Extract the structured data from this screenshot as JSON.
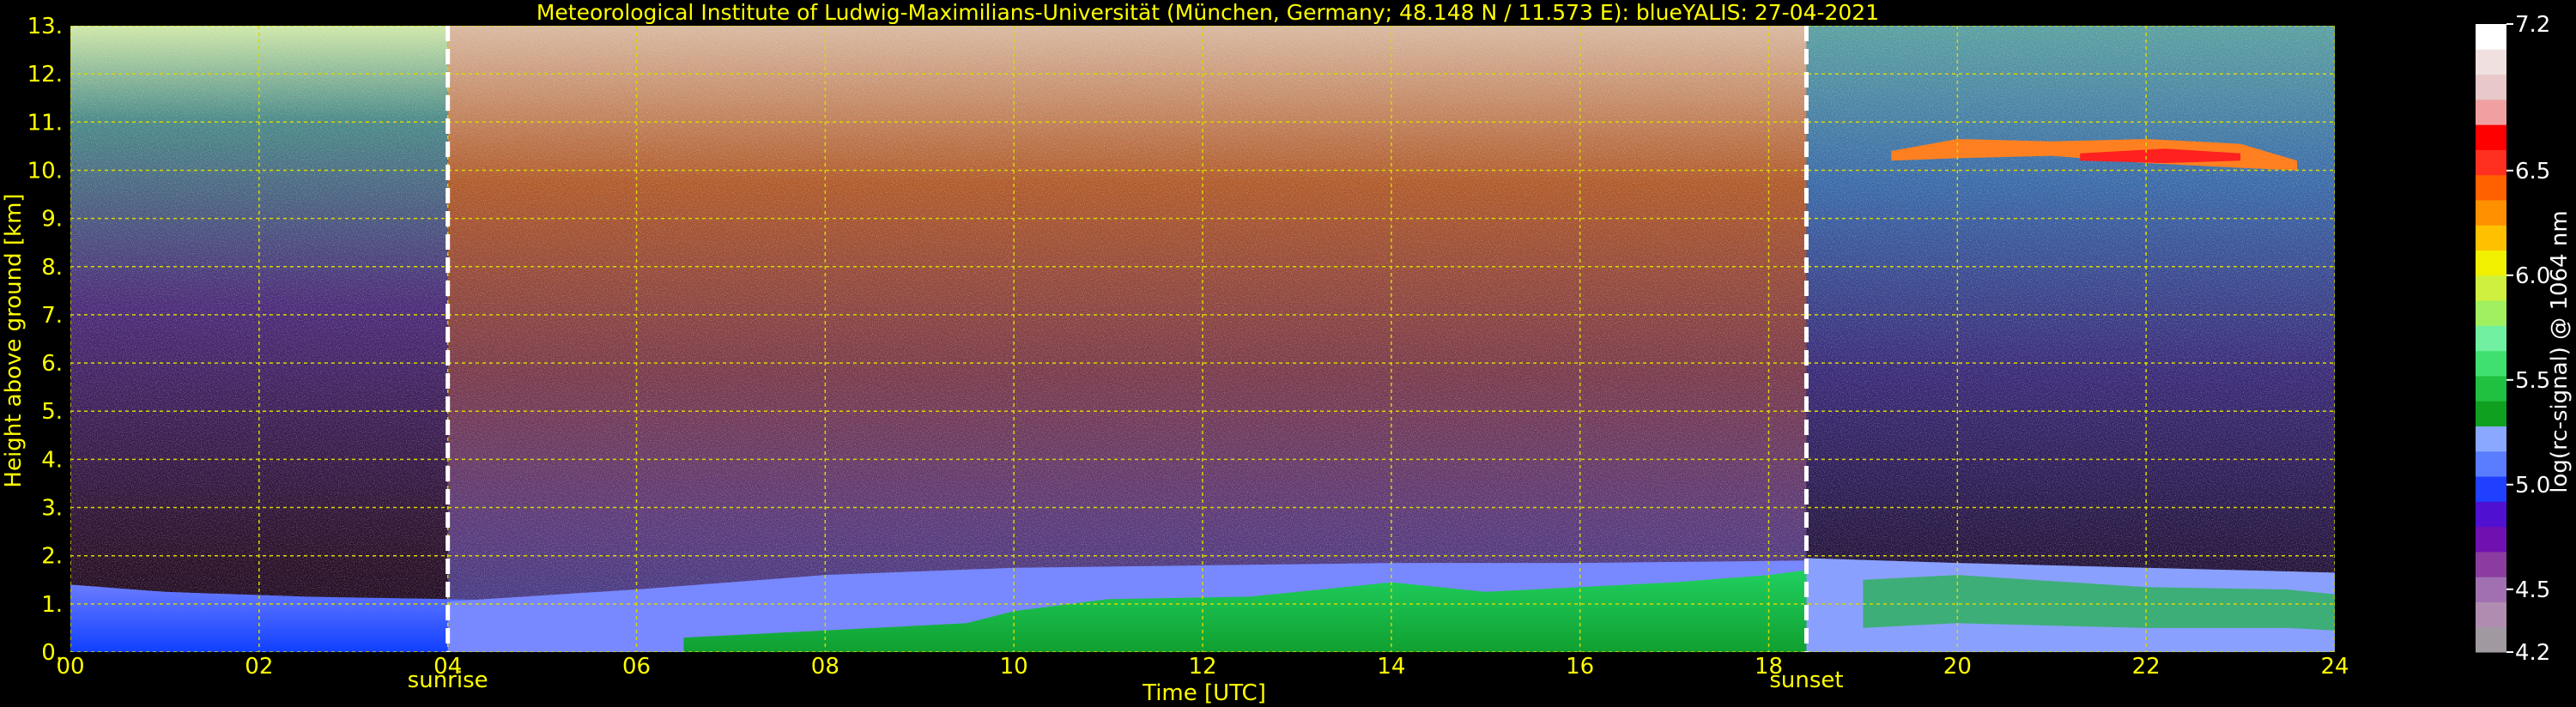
{
  "chart_data": {
    "type": "heatmap",
    "title": "Meteorological Institute of Ludwig-Maximilians-Universität (München, Germany; 48.148 N / 11.573 E):    blueYALIS: 27-04-2021",
    "xlabel": "Time [UTC]",
    "ylabel": "Height above ground [km]",
    "xlim": [
      0,
      24
    ],
    "ylim": [
      0,
      13
    ],
    "x_ticks": [
      "00",
      "02",
      "04",
      "06",
      "08",
      "10",
      "12",
      "14",
      "16",
      "18",
      "20",
      "22",
      "24"
    ],
    "y_ticks": [
      "0.",
      "1.",
      "2.",
      "3.",
      "4.",
      "5.",
      "6.",
      "7.",
      "8.",
      "9.",
      "10.",
      "11.",
      "12.",
      "13."
    ],
    "grid": true,
    "markers": [
      {
        "label": "sunrise",
        "x": 4.0
      },
      {
        "label": "sunset",
        "x": 18.4
      }
    ],
    "colorbar": {
      "label": "log(rc-signal) @ 1064 nm",
      "range": [
        4.2,
        7.2
      ],
      "ticks": [
        "4.2",
        "4.5",
        "5.0",
        "5.5",
        "6.0",
        "6.5",
        "7.2"
      ],
      "colors": [
        "#a09aa0",
        "#b08cb0",
        "#a070b0",
        "#8a3ca0",
        "#7010b0",
        "#5010d0",
        "#2040ff",
        "#5a7cff",
        "#8aa8ff",
        "#10a020",
        "#20c040",
        "#40e070",
        "#70f0a0",
        "#a0f060",
        "#d0f040",
        "#f0f000",
        "#ffc000",
        "#ff9000",
        "#ff6000",
        "#ff3020",
        "#ff0000",
        "#f0a0a0",
        "#e8c8c8",
        "#f0e0e0",
        "#ffffff"
      ]
    },
    "series": [
      {
        "name": "",
        "layers": [
          {
            "x0": 0,
            "x1": 4,
            "y0": 0,
            "y1": 1.3,
            "value": 5.0
          },
          {
            "x0": 7,
            "x1": 18.4,
            "y0": 0,
            "y1": 1.2,
            "value": 5.4
          },
          {
            "x0": 18.4,
            "x1": 24,
            "y0": 0.3,
            "y1": 1.8,
            "value": 5.2
          },
          {
            "x0": 19.2,
            "x1": 23.6,
            "y0": 10.2,
            "y1": 10.7,
            "value": 6.1
          },
          {
            "x0": 4,
            "x1": 18.4,
            "y0": 4,
            "y1": 13,
            "value": 5.9
          }
        ]
      }
    ]
  }
}
